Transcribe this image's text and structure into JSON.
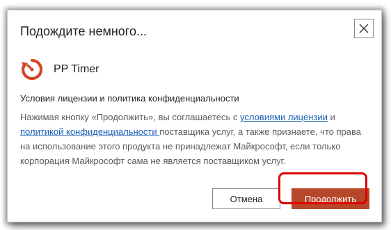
{
  "dialog": {
    "title": "Подождите немного...",
    "close_icon": "close-icon"
  },
  "app": {
    "name": "PP Timer",
    "icon": "timer-icon",
    "icon_color": "#d24726"
  },
  "license": {
    "heading": "Условия лицензии и политика конфиденциальности",
    "text_1": "Нажимая кнопку «Продолжить», вы соглашаетесь с ",
    "link_1": "условиями лицензии",
    "text_2": " и ",
    "link_2": "политикой конфиденциальности ",
    "text_3": "поставщика услуг, а также признаете, что права на использование этого продукта не принадлежат Майкрософт, если только корпорация Майкрософт сама не является поставщиком услуг.",
    "link_color": "#1a5fb4"
  },
  "buttons": {
    "cancel_label": "Отмена",
    "continue_label": "Продолжить",
    "continue_color": "#b7472a",
    "highlight_color": "#e00000"
  }
}
